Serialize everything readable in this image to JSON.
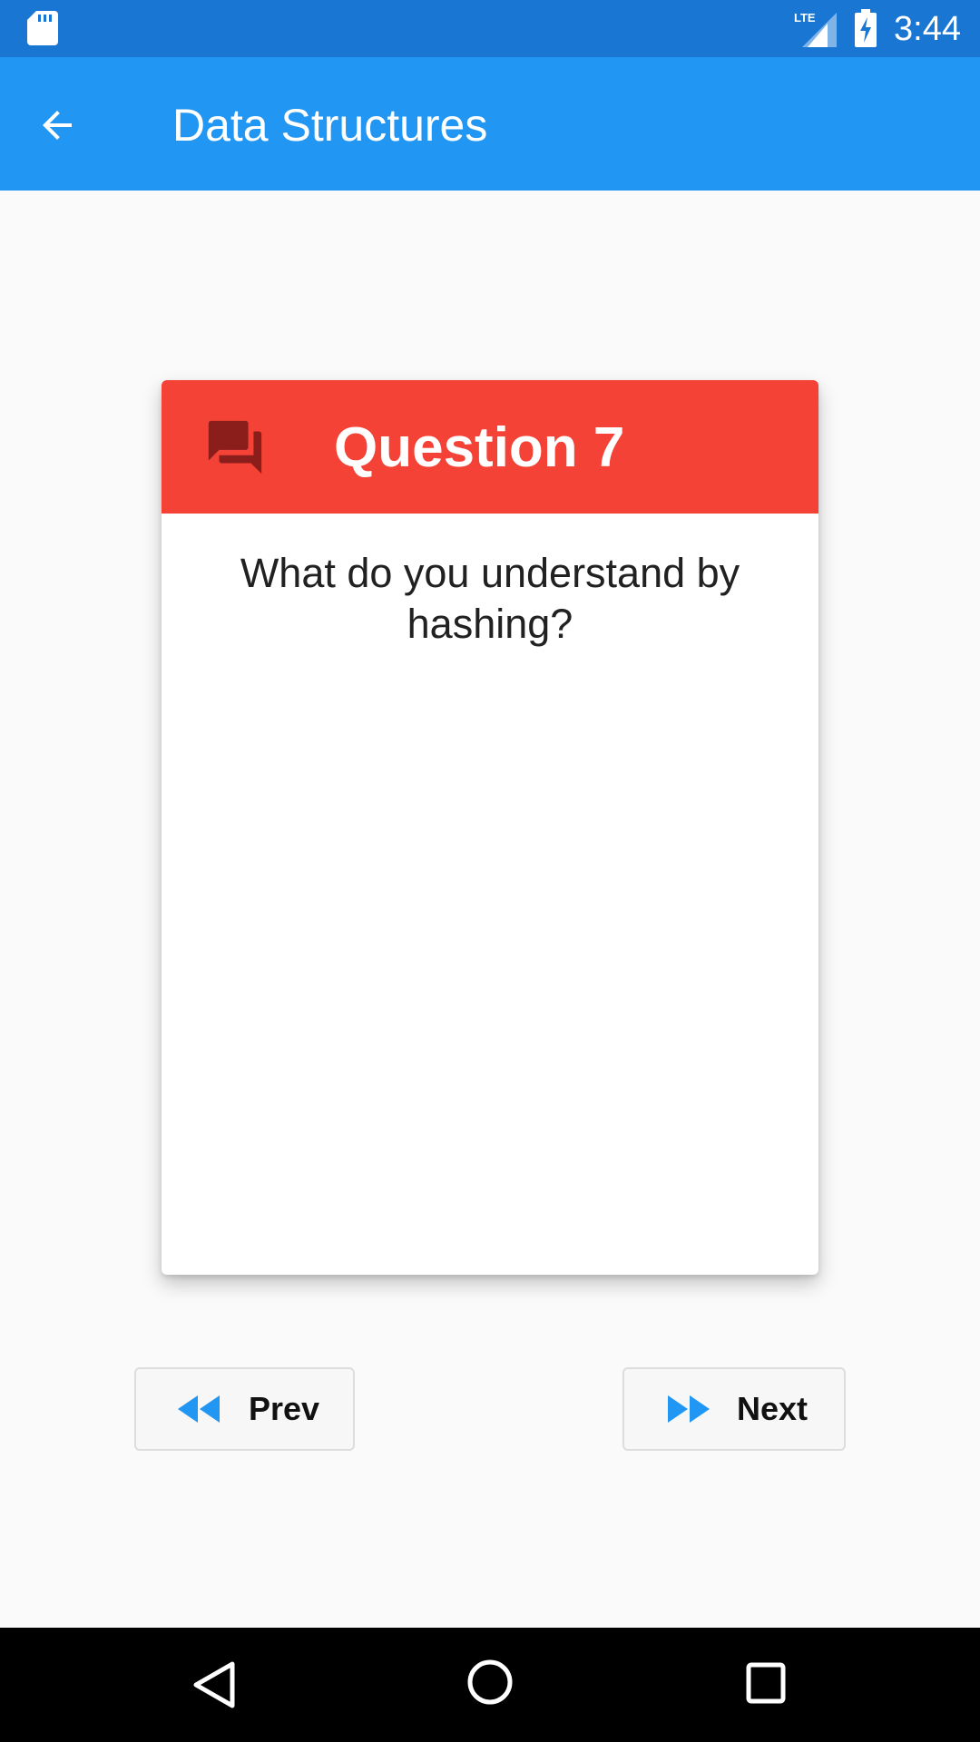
{
  "status_bar": {
    "time": "3:44",
    "network_label": "LTE",
    "icons": [
      "sd-card-icon",
      "lte-signal-icon",
      "battery-charging-icon"
    ]
  },
  "app_bar": {
    "title": "Data Structures",
    "back_icon": "arrow-back-icon"
  },
  "card": {
    "header_icon": "question-answer-icon",
    "title": "Question 7",
    "question": "What do you understand by hashing?"
  },
  "navigation": {
    "prev_label": "Prev",
    "prev_icon": "fast-rewind-icon",
    "next_label": "Next",
    "next_icon": "fast-forward-icon"
  },
  "system_nav": {
    "icons": [
      "nav-back-icon",
      "nav-home-icon",
      "nav-recents-icon"
    ]
  },
  "colors": {
    "status_bar": "#1976d2",
    "app_bar": "#2196f3",
    "card_header": "#f44336",
    "header_icon": "#8b1e1a",
    "nav_icon_accent": "#2196f3",
    "background": "#fafafa"
  }
}
